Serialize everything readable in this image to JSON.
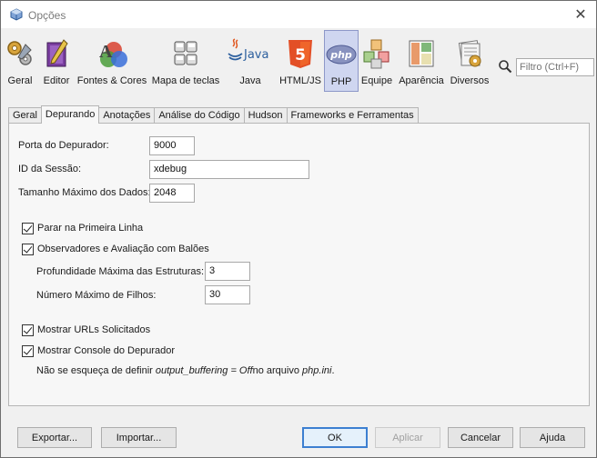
{
  "window": {
    "title": "Opções"
  },
  "toolbar": {
    "categories": [
      {
        "label": "Geral",
        "icon": "gears-icon"
      },
      {
        "label": "Editor",
        "icon": "editor-pencil-icon"
      },
      {
        "label": "Fontes & Cores",
        "icon": "fonts-colors-icon"
      },
      {
        "label": "Mapa de teclas",
        "icon": "keyboard-icon"
      },
      {
        "label": "Java",
        "icon": "java-icon"
      },
      {
        "label": "HTML/JS",
        "icon": "html5-icon"
      },
      {
        "label": "PHP",
        "icon": "php-icon",
        "selected": true
      },
      {
        "label": "Equipe",
        "icon": "team-cubes-icon"
      },
      {
        "label": "Aparência",
        "icon": "appearance-icon"
      },
      {
        "label": "Diversos",
        "icon": "misc-icon"
      }
    ],
    "java_logo_text": "Java",
    "php_logo_text": "php",
    "html5_logo_text": "5",
    "filter_placeholder": "Filtro (Ctrl+F)"
  },
  "tabs": [
    "Geral",
    "Depurando",
    "Anotações",
    "Análise do Código",
    "Hudson",
    "Frameworks e Ferramentas"
  ],
  "active_tab": "Depurando",
  "form": {
    "port_label": "Porta do Depurador:",
    "port_value": "9000",
    "session_label": "ID da Sessão:",
    "session_value": "xdebug",
    "maxdata_label": "Tamanho Máximo dos Dados:",
    "maxdata_value": "2048",
    "stop_first_line": "Parar na Primeira Linha",
    "watches_balloons": "Observadores e Avaliação com Balões",
    "max_depth_label": "Profundidade Máxima das Estruturas:",
    "max_depth_value": "3",
    "max_children_label": "Número Máximo de Filhos:",
    "max_children_value": "30",
    "show_urls": "Mostrar URLs Solicitados",
    "show_console": "Mostrar Console do Depurador",
    "note_prefix": "Não se esqueça de definir ",
    "note_setting": "output_buffering = Off",
    "note_middle": "no arquivo ",
    "note_file": "php.ini",
    "note_suffix": "."
  },
  "buttons": {
    "export": "Exportar...",
    "import": "Importar...",
    "ok": "OK",
    "apply": "Aplicar",
    "cancel": "Cancelar",
    "help": "Ajuda"
  }
}
